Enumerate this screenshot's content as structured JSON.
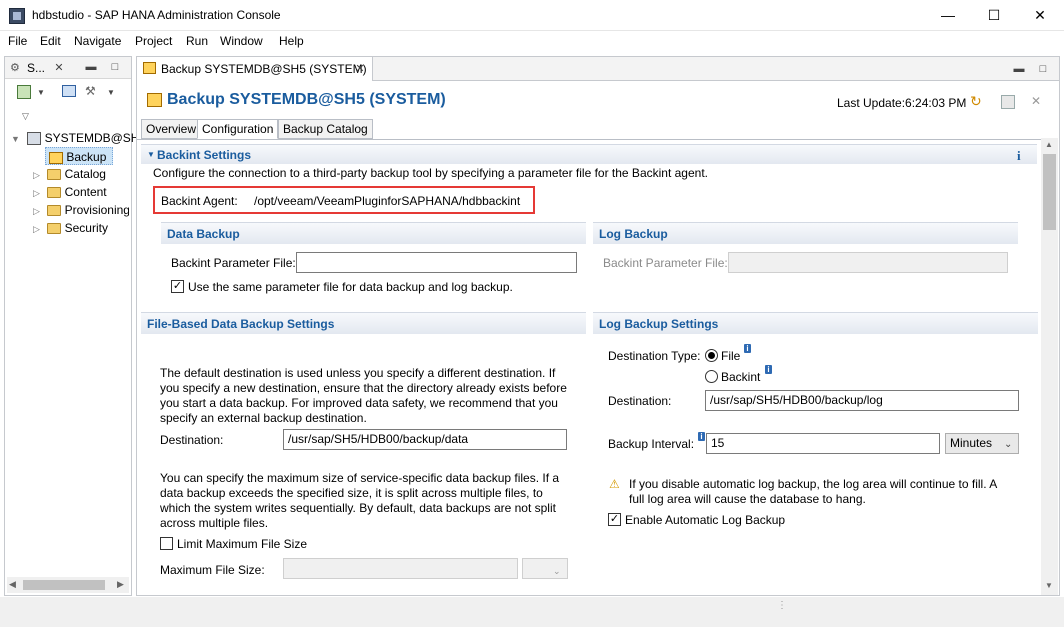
{
  "window": {
    "title": "hdbstudio - SAP HANA Administration Console",
    "minimize": "—",
    "maximize": "☐",
    "close": "✕"
  },
  "menu": [
    "File",
    "Edit",
    "Navigate",
    "Project",
    "Run",
    "Window",
    "Help"
  ],
  "left_panel": {
    "tab_label": "S...",
    "tree": {
      "root": "SYSTEMDB@SH5",
      "selected": "Backup",
      "children": [
        "Catalog",
        "Content",
        "Provisioning",
        "Security"
      ]
    }
  },
  "editor": {
    "tab_label": "Backup SYSTEMDB@SH5 (SYSTEM)",
    "header_title": "Backup SYSTEMDB@SH5 (SYSTEM)",
    "last_update": "Last Update:6:24:03 PM",
    "sub_tabs": [
      "Overview",
      "Configuration",
      "Backup Catalog"
    ],
    "active_sub_tab": "Configuration"
  },
  "backint": {
    "section_title": "Backint Settings",
    "description": "Configure the connection to a third-party backup tool by specifying a parameter file for the Backint agent.",
    "agent_label": "Backint Agent:",
    "agent_path": "/opt/veeam/VeeamPluginforSAPHANA/hdbbackint",
    "highlight_color": "#e53935",
    "data_backup": {
      "title": "Data Backup",
      "param_label": "Backint Parameter File:",
      "param_value": "",
      "same_file_label": "Use the same parameter file for data backup and log backup.",
      "same_file_checked": true
    },
    "log_backup": {
      "title": "Log Backup",
      "param_label": "Backint Parameter File:",
      "param_value": ""
    }
  },
  "file_based": {
    "title": "File-Based Data Backup Settings",
    "intro": "The default destination is used unless you specify a different destination. If you specify a new destination, ensure that the directory already exists before you start a data backup. For improved data safety, we recommend that you specify an external backup destination.",
    "destination_label": "Destination:",
    "destination_value": "/usr/sap/SH5/HDB00/backup/data",
    "size_text": "You can specify the maximum size of service-specific data backup files. If a data backup exceeds the specified size, it is split across multiple files, to which the system writes sequentially. By default, data backups are not split across multiple files.",
    "limit_label": "Limit Maximum File Size",
    "limit_checked": false,
    "max_size_label": "Maximum File Size:",
    "max_size_value": ""
  },
  "log_settings": {
    "title": "Log Backup Settings",
    "dest_type_label": "Destination Type:",
    "option_file": "File",
    "option_backint": "Backint",
    "selected_type": "File",
    "destination_label": "Destination:",
    "destination_value": "/usr/sap/SH5/HDB00/backup/log",
    "interval_label": "Backup Interval:",
    "interval_value": "15",
    "interval_unit": "Minutes",
    "warning": "If you disable automatic log backup, the log area will continue to fill. A full log area will cause the database to hang.",
    "auto_label": "Enable Automatic Log Backup",
    "auto_checked": true
  },
  "colors": {
    "section_title": "#1a5c9e",
    "header_title": "#1a5c9e"
  }
}
